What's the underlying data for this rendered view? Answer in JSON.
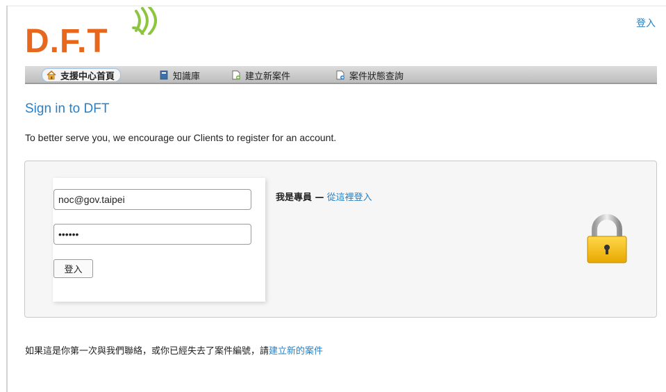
{
  "header": {
    "login_link": "登入",
    "logo_text": "D.F.T"
  },
  "nav": {
    "items": [
      {
        "label": "支援中心首頁",
        "icon": "home-icon"
      },
      {
        "label": "知識庫",
        "icon": "book-icon"
      },
      {
        "label": "建立新案件",
        "icon": "new-ticket-icon"
      },
      {
        "label": "案件狀態查詢",
        "icon": "ticket-status-icon"
      }
    ]
  },
  "main": {
    "title": "Sign in to DFT",
    "intro": "To better serve you, we encourage our Clients to register for an account."
  },
  "login_form": {
    "email_value": "noc@gov.taipei",
    "password_value": "••••••",
    "submit_label": "登入"
  },
  "agent": {
    "prefix": "我是專員 —",
    "link": "從這裡登入"
  },
  "footer": {
    "text": "如果這是你第一次與我們聯絡，或你已經失去了案件編號，請",
    "link": "建立新的案件"
  },
  "colors": {
    "accent": "#2a7fc2",
    "logo": "#e8671f",
    "logo_wifi": "#8cc63e",
    "lock_body": "#f5c000"
  }
}
